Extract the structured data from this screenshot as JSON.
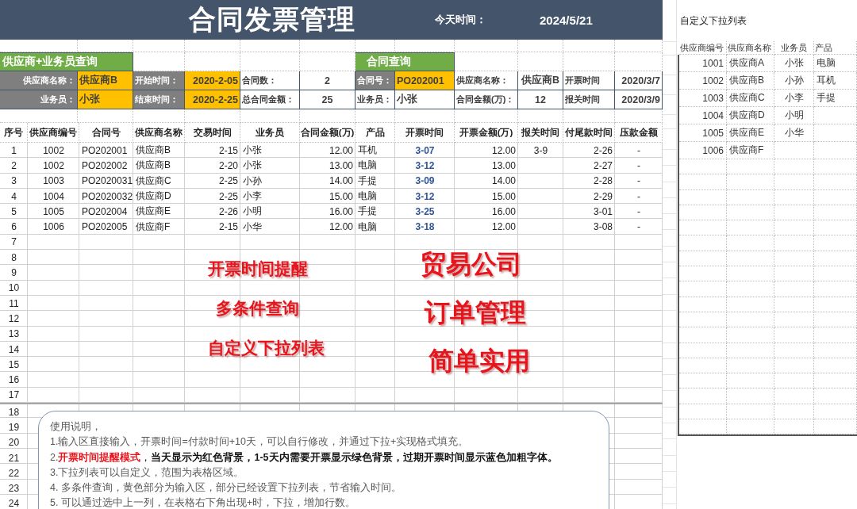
{
  "title": "合同发票管理",
  "today_label": "今天时间：",
  "today": "2024/5/21",
  "supplier_query": {
    "heading": "供应商+业务员查询",
    "fields": [
      {
        "label": "供应商名称：",
        "value": "供应商B",
        "kind": "input"
      },
      {
        "label": "开始时间：",
        "value": "2020-2-05",
        "kind": "input"
      },
      {
        "label": "合同数：",
        "value": "2",
        "kind": "result"
      },
      {
        "label": "业务员：",
        "value": "小张",
        "kind": "input"
      },
      {
        "label": "结束时间：",
        "value": "2020-2-25",
        "kind": "input"
      },
      {
        "label": "总合同金额：",
        "value": "25",
        "kind": "result"
      }
    ]
  },
  "contract_query": {
    "heading": "合同查询",
    "fields": [
      {
        "label": "合同号：",
        "value": "PO202001",
        "kind": "input"
      },
      {
        "label": "供应商名称：",
        "value": "供应商B",
        "kind": "result"
      },
      {
        "label": "开票时间",
        "value": "2020/3/7",
        "kind": "result"
      },
      {
        "label": "业务员：",
        "value": "小张",
        "kind": "result"
      },
      {
        "label": "合同金额(万)：",
        "value": "12",
        "kind": "result"
      },
      {
        "label": "报关时间",
        "value": "2020/3/9",
        "kind": "result"
      }
    ]
  },
  "table": {
    "columns": [
      "序号",
      "供应商编号",
      "合同号",
      "供应商名称",
      "交易时间",
      "业务员",
      "合同金额(万)",
      "产品",
      "开票时间",
      "开票金额(万)",
      "报关时间",
      "付尾款时间",
      "压款金额"
    ],
    "rows": [
      {
        "no": "1",
        "supplier_id": "1002",
        "contract_no": "PO202001",
        "supplier_name": "供应商B",
        "trade_date": "2-15",
        "salesperson": "小张",
        "amount": "12.00",
        "product": "耳机",
        "invoice_date": "3-07",
        "overdue": true,
        "invoice_amount": "12.00",
        "customs_date": "3-9",
        "final_payment_date": "2-26",
        "outstanding": "-"
      },
      {
        "no": "2",
        "supplier_id": "1002",
        "contract_no": "PO202002",
        "supplier_name": "供应商B",
        "trade_date": "2-20",
        "salesperson": "小张",
        "amount": "13.00",
        "product": "电脑",
        "invoice_date": "3-12",
        "overdue": true,
        "invoice_amount": "13.00",
        "final_payment_date": "2-27",
        "outstanding": "-"
      },
      {
        "no": "3",
        "supplier_id": "1003",
        "contract_no": "PO2020031",
        "supplier_name": "供应商C",
        "trade_date": "2-25",
        "salesperson": "小孙",
        "amount": "14.00",
        "product": "手提",
        "invoice_date": "3-09",
        "overdue": true,
        "invoice_amount": "14.00",
        "final_payment_date": "2-28",
        "outstanding": "-"
      },
      {
        "no": "4",
        "supplier_id": "1004",
        "contract_no": "PO2020032",
        "supplier_name": "供应商D",
        "trade_date": "2-25",
        "salesperson": "小李",
        "amount": "15.00",
        "product": "电脑",
        "invoice_date": "3-12",
        "overdue": true,
        "invoice_amount": "15.00",
        "final_payment_date": "2-29",
        "outstanding": "-"
      },
      {
        "no": "5",
        "supplier_id": "1005",
        "contract_no": "PO202004",
        "supplier_name": "供应商E",
        "trade_date": "2-26",
        "salesperson": "小明",
        "amount": "16.00",
        "product": "手提",
        "invoice_date": "3-25",
        "overdue": true,
        "invoice_amount": "16.00",
        "final_payment_date": "3-01",
        "outstanding": "-"
      },
      {
        "no": "6",
        "supplier_id": "1006",
        "contract_no": "PO202005",
        "supplier_name": "供应商F",
        "trade_date": "2-15",
        "salesperson": "小华",
        "amount": "12.00",
        "product": "电脑",
        "invoice_date": "3-18",
        "overdue": true,
        "invoice_amount": "12.00",
        "final_payment_date": "3-08",
        "outstanding": "-"
      },
      {
        "no": "7"
      },
      {
        "no": "8"
      },
      {
        "no": "9"
      },
      {
        "no": "10"
      },
      {
        "no": "11"
      },
      {
        "no": "12"
      },
      {
        "no": "13"
      },
      {
        "no": "14"
      },
      {
        "no": "15"
      },
      {
        "no": "16"
      },
      {
        "no": "17"
      },
      {
        "no": "18"
      },
      {
        "no": "19"
      },
      {
        "no": "20"
      },
      {
        "no": "21"
      },
      {
        "no": "22"
      },
      {
        "no": "23"
      },
      {
        "no": "24"
      }
    ]
  },
  "promo_left": [
    "开票时间提醒",
    "多条件查询",
    "自定义下拉列表"
  ],
  "promo_right": [
    "贸易公司",
    "订单管理",
    "简单实用"
  ],
  "notes": {
    "title": "使用说明，",
    "lines": [
      {
        "kind": "plain",
        "text": "1.输入区直接输入，开票时间=付款时间+10天，可以自行修改，并通过下拉+实现格式填充。"
      },
      {
        "kind": "alert",
        "number": "2.",
        "alert": "开票时间提醒模式",
        "text": "，**当天显示为红色背景，1-5天内需要开票显示绿色背景，过期开票时间显示蓝色加粗字体。**"
      },
      {
        "kind": "plain",
        "text": "3.下拉列表可以自定义，范围为表格区域。"
      },
      {
        "kind": "plain",
        "text": "4. 多条件查询，黄色部分为输入区，部分已经设置下拉列表，节省输入时间。"
      },
      {
        "kind": "plain",
        "text": "5. 可以通过选中上一列，在表格右下角出现+时，下拉，增加行数。"
      }
    ]
  },
  "dropdown_list": {
    "title": "自定义下拉列表",
    "columns": [
      "供应商编号",
      "供应商名称",
      "业务员",
      "产品"
    ],
    "rows": [
      {
        "id": "1001",
        "name": "供应商A",
        "salesperson": "小张",
        "product": "电脑"
      },
      {
        "id": "1002",
        "name": "供应商B",
        "salesperson": "小孙",
        "product": "耳机"
      },
      {
        "id": "1003",
        "name": "供应商C",
        "salesperson": "小李",
        "product": "手提"
      },
      {
        "id": "1004",
        "name": "供应商D",
        "salesperson": "小明"
      },
      {
        "id": "1005",
        "name": "供应商E",
        "salesperson": "小华"
      },
      {
        "id": "1006",
        "name": "供应商F"
      }
    ]
  }
}
